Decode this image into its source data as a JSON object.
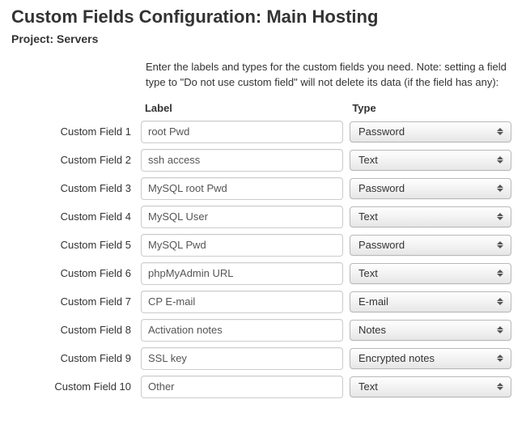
{
  "heading": "Custom Fields Configuration: Main Hosting",
  "subheading": "Project: Servers",
  "intro": "Enter the labels and types for the custom fields you need. Note: setting a field type to \"Do not use custom field\" will not delete its data (if the field has any):",
  "columns": {
    "label": "Label",
    "type": "Type"
  },
  "fields": [
    {
      "row": "Custom Field 1",
      "label": "root Pwd",
      "type": "Password"
    },
    {
      "row": "Custom Field 2",
      "label": "ssh access",
      "type": "Text"
    },
    {
      "row": "Custom Field 3",
      "label": "MySQL root Pwd",
      "type": "Password"
    },
    {
      "row": "Custom Field 4",
      "label": "MySQL User",
      "type": "Text"
    },
    {
      "row": "Custom Field 5",
      "label": "MySQL Pwd",
      "type": "Password"
    },
    {
      "row": "Custom Field 6",
      "label": "phpMyAdmin URL",
      "type": "Text"
    },
    {
      "row": "Custom Field 7",
      "label": "CP E-mail",
      "type": "E-mail"
    },
    {
      "row": "Custom Field 8",
      "label": "Activation notes",
      "type": "Notes"
    },
    {
      "row": "Custom Field 9",
      "label": "SSL key",
      "type": "Encrypted notes"
    },
    {
      "row": "Custom Field 10",
      "label": "Other",
      "type": "Text"
    }
  ]
}
